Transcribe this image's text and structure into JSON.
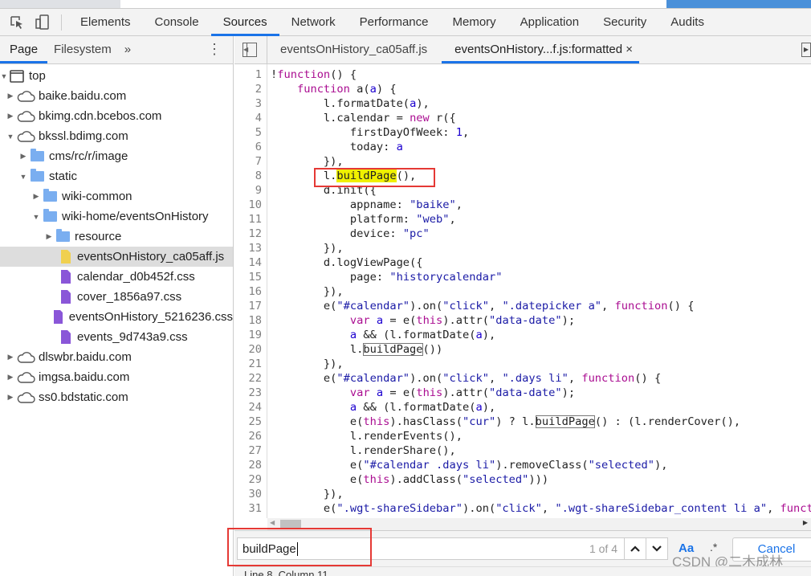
{
  "main_tabs": [
    "Elements",
    "Console",
    "Sources",
    "Network",
    "Performance",
    "Memory",
    "Application",
    "Security",
    "Audits"
  ],
  "active_main_tab": "Sources",
  "navigator": {
    "tabs": [
      "Page",
      "Filesystem"
    ],
    "more": "»",
    "menu": "⋮"
  },
  "tree": [
    {
      "label": "top",
      "level": 0,
      "icon": "frame",
      "open": true
    },
    {
      "label": "baike.baidu.com",
      "level": 1,
      "icon": "cloud",
      "open": false
    },
    {
      "label": "bkimg.cdn.bcebos.com",
      "level": 1,
      "icon": "cloud",
      "open": false
    },
    {
      "label": "bkssl.bdimg.com",
      "level": 1,
      "icon": "cloud",
      "open": true
    },
    {
      "label": "cms/rc/r/image",
      "level": 2,
      "icon": "folder",
      "open": false
    },
    {
      "label": "static",
      "level": 2,
      "icon": "folder",
      "open": true
    },
    {
      "label": "wiki-common",
      "level": 3,
      "icon": "folder",
      "open": false
    },
    {
      "label": "wiki-home/eventsOnHistory",
      "level": 3,
      "icon": "folder",
      "open": true
    },
    {
      "label": "resource",
      "level": 4,
      "icon": "folder",
      "open": false
    },
    {
      "label": "eventsOnHistory_ca05aff.js",
      "level": 4,
      "icon": "js",
      "selected": true
    },
    {
      "label": "calendar_d0b452f.css",
      "level": 4,
      "icon": "css"
    },
    {
      "label": "cover_1856a97.css",
      "level": 4,
      "icon": "css"
    },
    {
      "label": "eventsOnHistory_5216236.css",
      "level": 4,
      "icon": "css"
    },
    {
      "label": "events_9d743a9.css",
      "level": 4,
      "icon": "css"
    },
    {
      "label": "dlswbr.baidu.com",
      "level": 1,
      "icon": "cloud",
      "open": false
    },
    {
      "label": "imgsa.baidu.com",
      "level": 1,
      "icon": "cloud",
      "open": false
    },
    {
      "label": "ss0.bdstatic.com",
      "level": 1,
      "icon": "cloud",
      "open": false
    }
  ],
  "editor_tabs": [
    {
      "label": "eventsOnHistory_ca05aff.js"
    },
    {
      "label": "eventsOnHistory...f.js:formatted",
      "active": true,
      "close": "×"
    }
  ],
  "code": [
    [
      [
        "p",
        "!"
      ],
      [
        "k",
        "function"
      ],
      [
        "p",
        "() {"
      ]
    ],
    [
      [
        "p",
        "    "
      ],
      [
        "k",
        "function"
      ],
      [
        "p",
        " a("
      ],
      [
        "v",
        "a"
      ],
      [
        "p",
        ") {"
      ]
    ],
    [
      [
        "p",
        "        l.formatDate("
      ],
      [
        "v",
        "a"
      ],
      [
        "p",
        "),"
      ]
    ],
    [
      [
        "p",
        "        l.calendar = "
      ],
      [
        "k",
        "new"
      ],
      [
        "p",
        " r({"
      ]
    ],
    [
      [
        "p",
        "            firstDayOfWeek: "
      ],
      [
        "n",
        "1"
      ],
      [
        "p",
        ","
      ]
    ],
    [
      [
        "p",
        "            today: "
      ],
      [
        "v",
        "a"
      ]
    ],
    [
      [
        "p",
        "        }),"
      ]
    ],
    [
      [
        "p",
        "        l."
      ],
      [
        "hl",
        "buildPage"
      ],
      [
        "p",
        "(),"
      ]
    ],
    [
      [
        "p",
        "        d.init({"
      ]
    ],
    [
      [
        "p",
        "            appname: "
      ],
      [
        "s",
        "\"baike\""
      ],
      [
        "p",
        ","
      ]
    ],
    [
      [
        "p",
        "            platform: "
      ],
      [
        "s",
        "\"web\""
      ],
      [
        "p",
        ","
      ]
    ],
    [
      [
        "p",
        "            device: "
      ],
      [
        "s",
        "\"pc\""
      ]
    ],
    [
      [
        "p",
        "        }),"
      ]
    ],
    [
      [
        "p",
        "        d.logViewPage({"
      ]
    ],
    [
      [
        "p",
        "            page: "
      ],
      [
        "s",
        "\"historycalendar\""
      ]
    ],
    [
      [
        "p",
        "        }),"
      ]
    ],
    [
      [
        "p",
        "        e("
      ],
      [
        "s",
        "\"#calendar\""
      ],
      [
        "p",
        ").on("
      ],
      [
        "s",
        "\"click\""
      ],
      [
        "p",
        ", "
      ],
      [
        "s",
        "\".datepicker a\""
      ],
      [
        "p",
        ", "
      ],
      [
        "k",
        "function"
      ],
      [
        "p",
        "() {"
      ]
    ],
    [
      [
        "p",
        "            "
      ],
      [
        "k",
        "var"
      ],
      [
        "p",
        " "
      ],
      [
        "v",
        "a"
      ],
      [
        "p",
        " = e("
      ],
      [
        "k",
        "this"
      ],
      [
        "p",
        ").attr("
      ],
      [
        "s",
        "\"data-date\""
      ],
      [
        "p",
        ");"
      ]
    ],
    [
      [
        "p",
        "            "
      ],
      [
        "v",
        "a"
      ],
      [
        "p",
        " && (l.formatDate("
      ],
      [
        "v",
        "a"
      ],
      [
        "p",
        "),"
      ]
    ],
    [
      [
        "p",
        "            l."
      ],
      [
        "mt",
        "buildPage"
      ],
      [
        "p",
        "())"
      ]
    ],
    [
      [
        "p",
        "        }),"
      ]
    ],
    [
      [
        "p",
        "        e("
      ],
      [
        "s",
        "\"#calendar\""
      ],
      [
        "p",
        ").on("
      ],
      [
        "s",
        "\"click\""
      ],
      [
        "p",
        ", "
      ],
      [
        "s",
        "\".days li\""
      ],
      [
        "p",
        ", "
      ],
      [
        "k",
        "function"
      ],
      [
        "p",
        "() {"
      ]
    ],
    [
      [
        "p",
        "            "
      ],
      [
        "k",
        "var"
      ],
      [
        "p",
        " "
      ],
      [
        "v",
        "a"
      ],
      [
        "p",
        " = e("
      ],
      [
        "k",
        "this"
      ],
      [
        "p",
        ").attr("
      ],
      [
        "s",
        "\"data-date\""
      ],
      [
        "p",
        ");"
      ]
    ],
    [
      [
        "p",
        "            "
      ],
      [
        "v",
        "a"
      ],
      [
        "p",
        " && (l.formatDate("
      ],
      [
        "v",
        "a"
      ],
      [
        "p",
        "),"
      ]
    ],
    [
      [
        "p",
        "            e("
      ],
      [
        "k",
        "this"
      ],
      [
        "p",
        ").hasClass("
      ],
      [
        "s",
        "\"cur\""
      ],
      [
        "p",
        ") ? l."
      ],
      [
        "mt",
        "buildPage"
      ],
      [
        "p",
        "() : (l.renderCover(),"
      ]
    ],
    [
      [
        "p",
        "            l.renderEvents(),"
      ]
    ],
    [
      [
        "p",
        "            l.renderShare(),"
      ]
    ],
    [
      [
        "p",
        "            e("
      ],
      [
        "s",
        "\"#calendar .days li\""
      ],
      [
        "p",
        ").removeClass("
      ],
      [
        "s",
        "\"selected\""
      ],
      [
        "p",
        "),"
      ]
    ],
    [
      [
        "p",
        "            e("
      ],
      [
        "k",
        "this"
      ],
      [
        "p",
        ").addClass("
      ],
      [
        "s",
        "\"selected\""
      ],
      [
        "p",
        ")))"
      ]
    ],
    [
      [
        "p",
        "        }),"
      ]
    ],
    [
      [
        "p",
        "        e("
      ],
      [
        "s",
        "\".wgt-shareSidebar\""
      ],
      [
        "p",
        ").on("
      ],
      [
        "s",
        "\"click\""
      ],
      [
        "p",
        ", "
      ],
      [
        "s",
        "\".wgt-shareSidebar_content li a\""
      ],
      [
        "p",
        ", "
      ],
      [
        "k",
        "funct"
      ]
    ],
    [
      [
        "p",
        ""
      ]
    ]
  ],
  "search": {
    "value": "buildPage",
    "match_count": "1 of 4",
    "case_label": "Aa",
    "regex_label": ".*",
    "cancel_label": "Cancel"
  },
  "status": "Line 8, Column 11",
  "watermark": "CSDN @二木成林",
  "colors": {
    "accent": "#1a73e8",
    "highlight": "#f0f000",
    "annotation": "#e53935"
  }
}
